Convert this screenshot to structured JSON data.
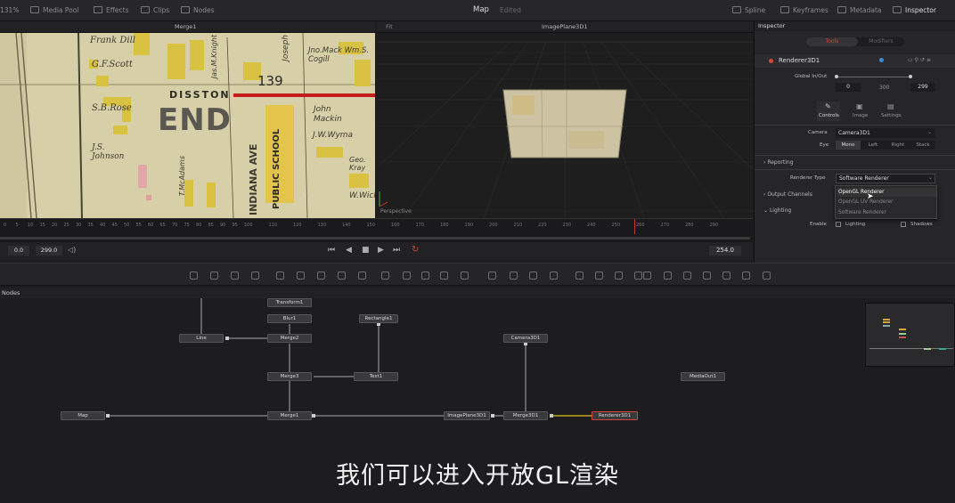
{
  "topbar": {
    "zoom": "131%",
    "media_pool": "Media Pool",
    "effects": "Effects",
    "clips": "Clips",
    "nodes": "Nodes",
    "title": "Map",
    "status": "Edited",
    "spline": "Spline",
    "keyframes": "Keyframes",
    "metadata": "Metadata",
    "inspector": "Inspector"
  },
  "viewer_left": {
    "title": "Merge1"
  },
  "viewer_right": {
    "title": "ImagePlane3D1",
    "fit": "Fit",
    "perspective": "Perspective"
  },
  "map_text": {
    "l1": "Frank Dill",
    "l2": "G.F.Scott",
    "l3": "S.B.Rose",
    "l4": "J.S. Johnson",
    "l5": "DISSTON",
    "l6": "END",
    "l7": "139",
    "l8": "Jas.M.Knight",
    "l9": "Jno.Mack Wm.S. Cogill",
    "l10": "John Mackin",
    "l11": "J.W.Wyma",
    "l12": "INDIANA AVE",
    "l13": "PUBLIC SCHOOL",
    "l14": "T.McAdams",
    "l15": "Geo. Kray",
    "l16": "W.Wick",
    "l17": "Joseph"
  },
  "ruler": [
    "0",
    "5",
    "10",
    "15",
    "20",
    "25",
    "30",
    "35",
    "40",
    "45",
    "50",
    "55",
    "60",
    "65",
    "70",
    "75",
    "80",
    "85",
    "90",
    "95",
    "100",
    "110",
    "120",
    "130",
    "140",
    "150",
    "160",
    "170",
    "180",
    "190",
    "200",
    "210",
    "220",
    "230",
    "240",
    "250",
    "260",
    "270",
    "280",
    "290"
  ],
  "transport": {
    "start": "0.0",
    "end": "299.0",
    "current": "254.0"
  },
  "nodes_label": "Nodes",
  "nodes": {
    "transform": "Transform1",
    "blur": "Blur1",
    "rectangle": "Rectangle1",
    "line": "Line",
    "merge2": "Merge2",
    "merge3": "Merge3",
    "text1": "Text1",
    "map": "Map",
    "merge1": "Merge1",
    "camera": "Camera3D1",
    "mediaout": "MediaOut1",
    "imageplane": "ImagePlane3D1",
    "merge3d": "Merge3D1",
    "renderer": "Renderer3D1"
  },
  "inspector": {
    "title": "Inspector",
    "tab_tools": "Tools",
    "tab_modifiers": "Modifiers",
    "node_name": "Renderer3D1",
    "global_inout": "Global In/Out",
    "in": "0",
    "mid": "300",
    "out": "299",
    "subtab_controls": "Controls",
    "subtab_image": "Image",
    "subtab_settings": "Settings",
    "camera_label": "Camera",
    "camera_value": "Camera3D1",
    "eye_label": "Eye",
    "eye_mono": "Mono",
    "eye_left": "Left",
    "eye_right": "Right",
    "eye_stack": "Stack",
    "reporting": "Reporting",
    "renderer_type_label": "Renderer Type",
    "renderer_type_value": "Software Renderer",
    "output_channels": "Output Channels",
    "lighting": "Lighting",
    "enable_label": "Enable",
    "lighting_check": "Lighting",
    "shadows_check": "Shadows",
    "dropdown_options": [
      "OpenGL Renderer",
      "OpenGL UV Renderer",
      "Software Renderer"
    ]
  },
  "subtitle": "我们可以进入开放GL渲染",
  "colors": {
    "accent_red": "#d6433c",
    "playhead": "#c0392b",
    "background": "#1c1c1e"
  }
}
